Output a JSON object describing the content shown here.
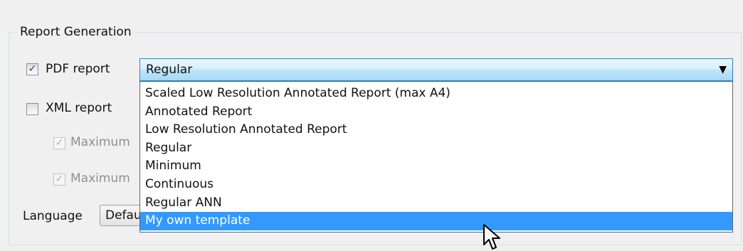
{
  "group": {
    "title": "Report Generation"
  },
  "pdf_report": {
    "label": "PDF report",
    "checked": true,
    "check_glyph": "✓"
  },
  "xml_report": {
    "label": "XML report",
    "checked": false
  },
  "sub_options": [
    {
      "label": "Maximum",
      "checked": true,
      "disabled": true,
      "check_glyph": "✓"
    },
    {
      "label": "Maximum",
      "checked": true,
      "disabled": true,
      "check_glyph": "✓"
    }
  ],
  "template_combo": {
    "selected_value": "Regular",
    "arrow_icon": "▼",
    "options": [
      "Scaled Low Resolution Annotated Report (max A4)",
      "Annotated Report",
      "Low Resolution Annotated Report",
      "Regular",
      "Minimum",
      "Continuous",
      "Regular ANN",
      "My own template"
    ],
    "highlighted_option": "My own template"
  },
  "language": {
    "label": "Language",
    "value": "Default"
  },
  "colors": {
    "highlight": "#3399ff",
    "combo_border": "#3c7fb1"
  }
}
